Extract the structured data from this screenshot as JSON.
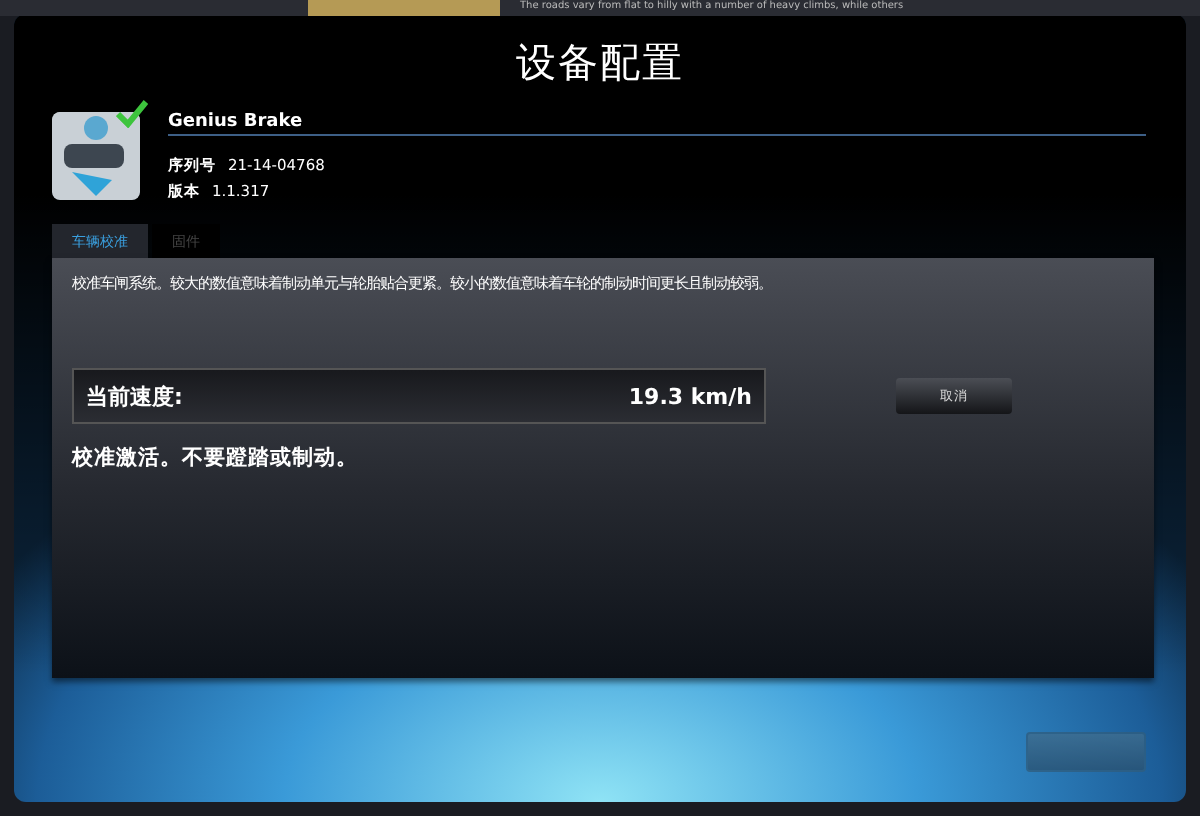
{
  "background": {
    "caption": "The roads vary from flat to hilly with a number of heavy climbs, while others"
  },
  "window": {
    "title": "设备配置"
  },
  "device": {
    "name": "Genius Brake",
    "connected": true,
    "serial_label": "序列号",
    "serial": "21-14-04768",
    "version_label": "版本",
    "version": "1.1.317"
  },
  "tabs": [
    {
      "label": "车辆校准",
      "selected": true
    },
    {
      "label": "固件",
      "selected": false
    }
  ],
  "calibration": {
    "description": "校准车闸系统。较大的数值意味着制动单元与轮胎贴合更紧。较小的数值意味着车轮的制动时间更长且制动较弱。",
    "speed_label": "当前速度:",
    "speed_value": "19.3 km/h",
    "cancel": "取消",
    "status": "校准激活。不要蹬踏或制动。"
  },
  "footer": {
    "button_disabled": true
  }
}
